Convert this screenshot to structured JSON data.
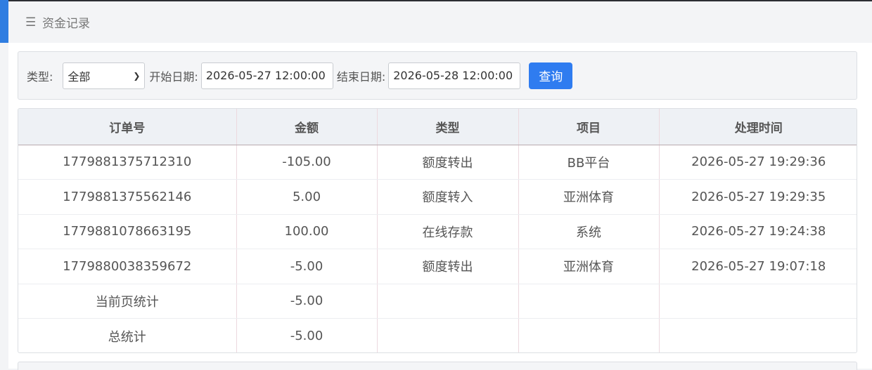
{
  "header": {
    "menu_icon": "☰",
    "title": "资金记录"
  },
  "filters": {
    "type_label": "类型:",
    "type_value": "全部",
    "start_label": "开始日期:",
    "start_value": "2026-05-27 12:00:00",
    "end_label": "结束日期:",
    "end_value": "2026-05-28 12:00:00",
    "query_label": "查询"
  },
  "table": {
    "headers": [
      "订单号",
      "金额",
      "类型",
      "项目",
      "处理时间"
    ],
    "rows": [
      [
        "1779881375712310",
        "-105.00",
        "额度转出",
        "BB平台",
        "2026-05-27 19:29:36"
      ],
      [
        "1779881375562146",
        "5.00",
        "额度转入",
        "亚洲体育",
        "2026-05-27 19:29:35"
      ],
      [
        "1779881078663195",
        "100.00",
        "在线存款",
        "系统",
        "2026-05-27 19:24:38"
      ],
      [
        "1779880038359672",
        "-5.00",
        "额度转出",
        "亚洲体育",
        "2026-05-27 19:07:18"
      ],
      [
        "当前页统计",
        "-5.00",
        "",
        "",
        ""
      ],
      [
        "总统计",
        "-5.00",
        "",
        "",
        ""
      ]
    ]
  },
  "colors": {
    "accent": "#2f7de1",
    "button": "#2f7cf0"
  }
}
